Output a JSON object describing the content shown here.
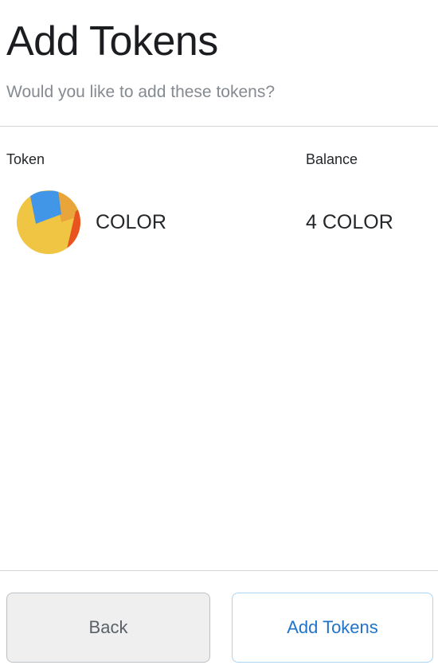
{
  "header": {
    "title": "Add Tokens",
    "subtitle": "Would you like to add these tokens?"
  },
  "table": {
    "columns": [
      "Token",
      "Balance"
    ],
    "rows": [
      {
        "icon": "jazzicon-avatar-icon",
        "symbol": "COLOR",
        "balance": "4 COLOR"
      }
    ]
  },
  "footer": {
    "back_label": "Back",
    "add_label": "Add Tokens"
  },
  "colors": {
    "accent": "#1f73c9",
    "icon_yellow": "#f0c543",
    "icon_blue": "#4296e8",
    "icon_orange": "#eaa53a",
    "icon_red": "#e9531f"
  }
}
